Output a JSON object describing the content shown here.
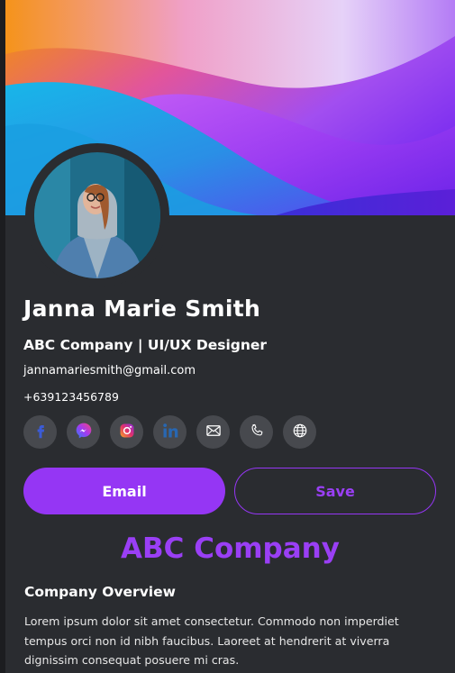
{
  "profile": {
    "name": "Janna Marie Smith",
    "role": "ABC Company | UI/UX Designer",
    "email": "jannamariesmith@gmail.com",
    "phone": "+639123456789"
  },
  "socials": [
    {
      "icon": "facebook-icon",
      "color": "#3b5bd6"
    },
    {
      "icon": "messenger-icon",
      "color": "#8b3ff5"
    },
    {
      "icon": "instagram-icon",
      "color": "#e1306c"
    },
    {
      "icon": "linkedin-icon",
      "color": "#2867b2"
    },
    {
      "icon": "mail-icon",
      "color": "#ffffff"
    },
    {
      "icon": "phone-icon",
      "color": "#ffffff"
    },
    {
      "icon": "globe-icon",
      "color": "#ffffff"
    }
  ],
  "actions": {
    "email_label": "Email",
    "save_label": "Save"
  },
  "company": {
    "title": "ABC Company",
    "overview_heading": "Company Overview",
    "overview_text": "Lorem ipsum dolor sit amet consectetur. Commodo non imperdiet tempus orci non id nibh faucibus. Laoreet at hendrerit at viverra dignissim consequat posuere mi cras."
  },
  "colors": {
    "accent": "#9536f4",
    "background": "#2a2c30",
    "icon_bg": "#47494e"
  }
}
